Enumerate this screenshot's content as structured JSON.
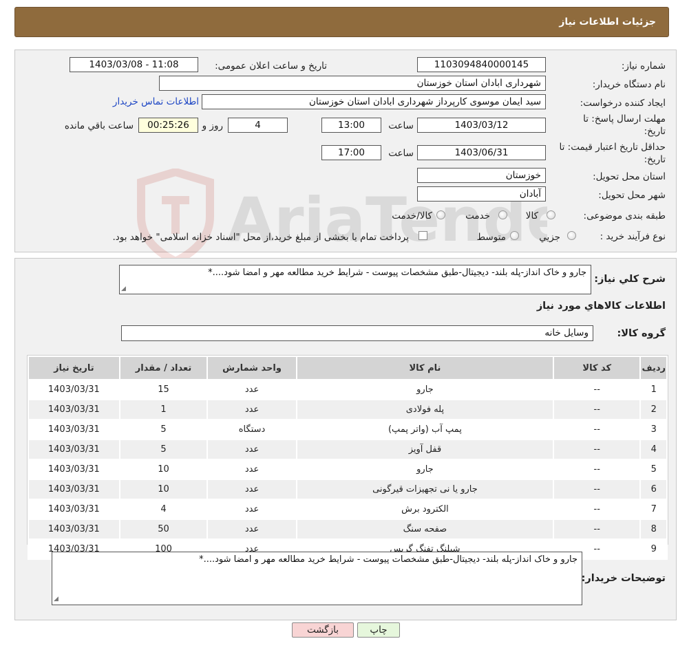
{
  "header": {
    "title": "جزئیات اطلاعات نیاز"
  },
  "form": {
    "need_number_label": "شماره نیاز:",
    "need_number": "1103094840000145",
    "announce_label": "تاریخ و ساعت اعلان عمومی:",
    "announce_value": "1403/03/08 - 11:08",
    "buyer_org_label": "نام دستگاه خریدار:",
    "buyer_org": "شهرداری ابادان استان خوزستان",
    "requester_label": "ایجاد کننده درخواست:",
    "requester": "سید ایمان موسوی کارپرداز شهرداری ابادان استان خوزستان",
    "contact_link": "اطلاعات تماس خریدار",
    "deadline_label_1": "مهلت ارسال پاسخ: تا",
    "deadline_label_2": "تاریخ:",
    "deadline_date": "1403/03/12",
    "time_label": "ساعت",
    "deadline_time": "13:00",
    "days_value": "4",
    "days_label": "روز و",
    "remaining_time": "00:25:26",
    "remaining_label": "ساعت باقي مانده",
    "validity_label_1": "حداقل تاریخ اعتبار قیمت: تا",
    "validity_label_2": "تاریخ:",
    "validity_date": "1403/06/31",
    "validity_time": "17:00",
    "province_label": "استان محل تحویل:",
    "province": "خوزستان",
    "city_label": "شهر محل تحویل:",
    "city": "آبادان",
    "category_label": "طبقه بندی موضوعی:",
    "category_options": [
      "کالا",
      "خدمت",
      "کالا/خدمت"
    ],
    "process_label": "نوع فرآیند خرید :",
    "process_options": [
      "جزیي",
      "متوسط"
    ],
    "payment_note": "پرداخت تمام یا بخشی از مبلغ خرید،از محل \"اسناد خزانه اسلامی\" خواهد بود."
  },
  "description": {
    "label": "شرح کلي نیاز:",
    "text": "جارو و خاک انداز-پله بلند- دیجیتال-طبق مشخصات پیوست - شرایط خرید مطالعه مهر و امضا شود....*"
  },
  "goods": {
    "section_title": "اطلاعات کالاهاي مورد نیاز",
    "group_label": "گروه کالا:",
    "group_value": "وسایل خانه",
    "columns": [
      "ردیف",
      "کد کالا",
      "نام کالا",
      "واحد شمارش",
      "تعداد / مقدار",
      "تاریخ نیاز"
    ],
    "rows": [
      [
        "1",
        "--",
        "جارو",
        "عدد",
        "15",
        "1403/03/31"
      ],
      [
        "2",
        "--",
        "پله فولادی",
        "عدد",
        "1",
        "1403/03/31"
      ],
      [
        "3",
        "--",
        "پمپ آب (واتر پمپ)",
        "دستگاه",
        "5",
        "1403/03/31"
      ],
      [
        "4",
        "--",
        "قفل آویز",
        "عدد",
        "5",
        "1403/03/31"
      ],
      [
        "5",
        "--",
        "جارو",
        "عدد",
        "10",
        "1403/03/31"
      ],
      [
        "6",
        "--",
        "جارو یا نی تجهیزات قیرگونی",
        "عدد",
        "10",
        "1403/03/31"
      ],
      [
        "7",
        "--",
        "الکترود برش",
        "عدد",
        "4",
        "1403/03/31"
      ],
      [
        "8",
        "--",
        "صفحه سنگ",
        "عدد",
        "50",
        "1403/03/31"
      ],
      [
        "9",
        "--",
        "شیلنگ تفنگ گریس",
        "عدد",
        "100",
        "1403/03/31"
      ]
    ]
  },
  "buyer_notes": {
    "label": "توضیحات خریدار:",
    "text": "جارو و خاک انداز-پله بلند- دیجیتال-طبق مشخصات پیوست - شرایط خرید مطالعه مهر و امضا شود....*"
  },
  "buttons": {
    "print": "چاپ",
    "back": "بازگشت"
  },
  "watermark_text": "AriaTender.neT",
  "colors": {
    "header": "#8f6b3d",
    "link": "#1d46c4",
    "back_button": "#f8d4d4",
    "print_button": "#e6f7dc",
    "countdown_bg": "#ffffdd"
  }
}
